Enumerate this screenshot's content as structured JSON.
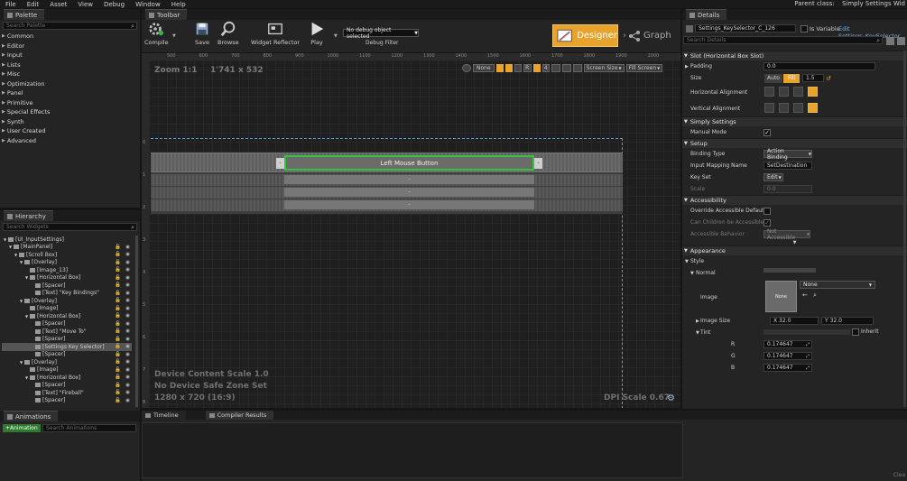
{
  "menu": [
    "File",
    "Edit",
    "Asset",
    "View",
    "Debug",
    "Window",
    "Help"
  ],
  "parent_class": {
    "label": "Parent class:",
    "value": "Simply Settings Wid"
  },
  "palette": {
    "title": "Palette",
    "search_placeholder": "Search Palette",
    "items": [
      "Common",
      "Editor",
      "Input",
      "Lists",
      "Misc",
      "Optimization",
      "Panel",
      "Primitive",
      "Special Effects",
      "Synth",
      "User Created",
      "Advanced"
    ]
  },
  "hierarchy": {
    "title": "Hierarchy",
    "search_placeholder": "Search Widgets",
    "rows": [
      {
        "label": "[UI_InputSettings]",
        "indent": 0
      },
      {
        "label": "[MainPanel]",
        "indent": 1
      },
      {
        "label": "[Scroll Box]",
        "indent": 2
      },
      {
        "label": "[Overlay]",
        "indent": 3
      },
      {
        "label": "[Image_13]",
        "indent": 4
      },
      {
        "label": "[Horizontal Box]",
        "indent": 4
      },
      {
        "label": "[Spacer]",
        "indent": 5
      },
      {
        "label": "[Text] \"Key Bindings\"",
        "indent": 5
      },
      {
        "label": "[Overlay]",
        "indent": 3
      },
      {
        "label": "[Image]",
        "indent": 4
      },
      {
        "label": "[Horizontal Box]",
        "indent": 4
      },
      {
        "label": "[Spacer]",
        "indent": 5
      },
      {
        "label": "[Text] \"Move To\"",
        "indent": 5
      },
      {
        "label": "[Spacer]",
        "indent": 5
      },
      {
        "label": "[Settings Key Selector]",
        "indent": 5,
        "selected": true
      },
      {
        "label": "[Spacer]",
        "indent": 5
      },
      {
        "label": "[Overlay]",
        "indent": 3
      },
      {
        "label": "[Image]",
        "indent": 4
      },
      {
        "label": "[Horizontal Box]",
        "indent": 4
      },
      {
        "label": "[Spacer]",
        "indent": 5
      },
      {
        "label": "[Text] \"Fireball\"",
        "indent": 5
      },
      {
        "label": "[Spacer]",
        "indent": 5
      }
    ]
  },
  "animations": {
    "title": "Animations",
    "add_label": "+Animation",
    "search_placeholder": "Search Animations"
  },
  "toolbar": {
    "title": "Toolbar",
    "compile": "Compile",
    "save": "Save",
    "browse": "Browse",
    "reflector": "Widget Reflector",
    "play": "Play",
    "debug_object": "No debug object selected",
    "debug_filter": "Debug Filter",
    "designer": "Designer",
    "graph": "Graph"
  },
  "canvas": {
    "zoom": "Zoom 1:1",
    "size": "1'741 x 532",
    "ruler_ticks": [
      "500",
      "600",
      "700",
      "800",
      "900",
      "1000",
      "1100",
      "1200",
      "1300",
      "1400",
      "1500",
      "1600",
      "1700",
      "1800",
      "1900",
      "2000",
      "2100"
    ],
    "top_controls": {
      "none": "None",
      "r": "R",
      "four": "4",
      "screen_size": "Screen Size",
      "fill_screen": "Fill Screen"
    },
    "key_button": "Left Mouse Button",
    "dash_rows": [
      "-",
      "-",
      "-"
    ],
    "info1": "Device Content Scale 1.0",
    "info2": "No Device Safe Zone Set",
    "info3": "1280 x 720 (16:9)",
    "dpi": "DPI Scale 0.67",
    "left_ticks": [
      "0",
      "1",
      "2",
      "3",
      "4",
      "5",
      "6",
      "7",
      "8"
    ]
  },
  "bottom_tabs": {
    "timeline": "Timeline",
    "compiler": "Compiler Results"
  },
  "details": {
    "title": "Details",
    "name": "Settings_KeySelector_C_126",
    "is_variable": "Is Variable",
    "edit_link": "Edit Settings_KeySelector",
    "search_placeholder": "Search Details",
    "sec_slot": "Slot (Horizontal Box Slot)",
    "padding_label": "Padding",
    "padding_value": "0.0",
    "size_label": "Size",
    "size_auto": "Auto",
    "size_fill": "Fill",
    "size_value": "1.5",
    "halign_label": "Horizontal Alignment",
    "valign_label": "Vertical Alignment",
    "sec_simply": "Simply Settings",
    "manual_mode": "Manual Mode",
    "sec_setup": "Setup",
    "binding_type_label": "Binding Type",
    "binding_type": "Action Binding",
    "mapping_label": "Input Mapping Name",
    "mapping": "SetDestination",
    "keyset_label": "Key Set",
    "keyset": "Edit",
    "scale_label": "Scale",
    "scale": "0.0",
    "sec_access": "Accessibility",
    "override": "Override Accessible Defaults",
    "children": "Can Children be Accessible",
    "behavior_label": "Accessible Behavior",
    "behavior": "Not Accessible",
    "sec_appearance": "Appearance",
    "style": "Style",
    "normal": "Normal",
    "image_label": "Image",
    "image_thumb": "None",
    "image_value": "None",
    "image_size_label": "Image Size",
    "image_x": "X 32.0",
    "image_y": "Y 32.0",
    "tint_label": "Tint",
    "inherit": "Inherit",
    "r_label": "R",
    "r": "0.174647",
    "g_label": "G",
    "g": "0.174647",
    "b_label": "B",
    "b": "0.174647",
    "corner": "Clea"
  },
  "colors": {
    "accent": "#e8a32d",
    "select_green": "#35c43b",
    "canvas_border": "#4aa3df"
  }
}
